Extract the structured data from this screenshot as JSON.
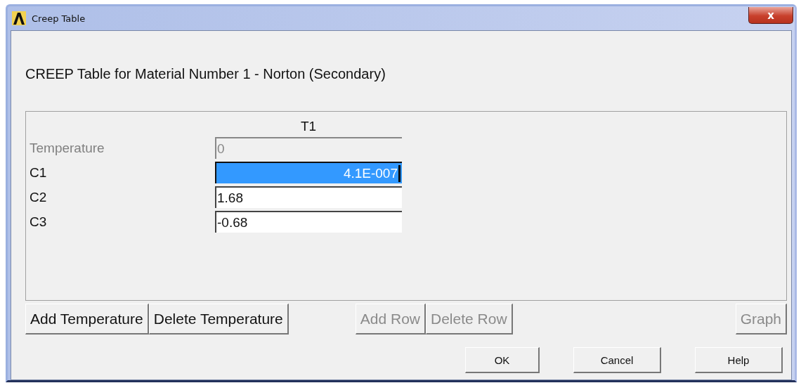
{
  "window": {
    "title": "Creep Table",
    "close": "x"
  },
  "heading": "CREEP Table for Material Number 1 - Norton (Secondary)",
  "table": {
    "columns": [
      "T1"
    ],
    "rows": [
      {
        "label": "Temperature",
        "value": "0",
        "disabled": true,
        "selected": false
      },
      {
        "label": "C1",
        "value": "4.1E-007",
        "disabled": false,
        "selected": true
      },
      {
        "label": "C2",
        "value": "1.68",
        "disabled": false,
        "selected": false
      },
      {
        "label": "C3",
        "value": "-0.68",
        "disabled": false,
        "selected": false
      }
    ]
  },
  "table_buttons": {
    "left": [
      {
        "label": "Add Temperature",
        "disabled": false
      },
      {
        "label": "Delete Temperature",
        "disabled": false
      }
    ],
    "middle": [
      {
        "label": "Add Row",
        "disabled": true
      },
      {
        "label": "Delete Row",
        "disabled": true
      }
    ],
    "right": [
      {
        "label": "Graph",
        "disabled": true
      }
    ]
  },
  "dialog_buttons": [
    "OK",
    "Cancel",
    "Help"
  ]
}
